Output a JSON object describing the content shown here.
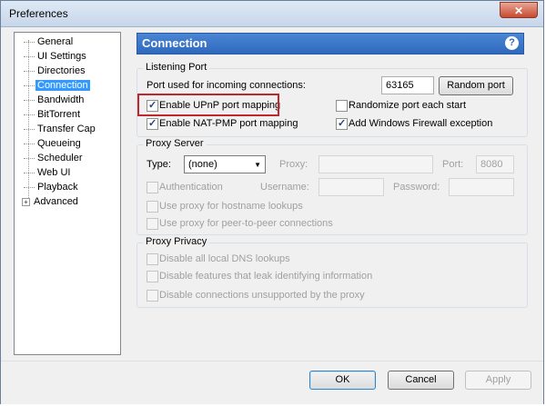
{
  "window": {
    "title": "Preferences",
    "close_glyph": "✕"
  },
  "sidebar": {
    "items": [
      {
        "label": "General"
      },
      {
        "label": "UI Settings"
      },
      {
        "label": "Directories"
      },
      {
        "label": "Connection",
        "selected": true
      },
      {
        "label": "Bandwidth"
      },
      {
        "label": "BitTorrent"
      },
      {
        "label": "Transfer Cap"
      },
      {
        "label": "Queueing"
      },
      {
        "label": "Scheduler"
      },
      {
        "label": "Web UI"
      },
      {
        "label": "Playback"
      },
      {
        "label": "Advanced",
        "expandable": true
      }
    ]
  },
  "header": {
    "title": "Connection",
    "help_glyph": "?"
  },
  "listening_port": {
    "group_label": "Listening Port",
    "port_label": "Port used for incoming connections:",
    "port_value": "63165",
    "random_port_label": "Random port",
    "upnp_label": "Enable UPnP port mapping",
    "upnp_checked": true,
    "natpmp_label": "Enable NAT-PMP port mapping",
    "natpmp_checked": true,
    "randomize_label": "Randomize port each start",
    "randomize_checked": false,
    "firewall_label": "Add Windows Firewall exception",
    "firewall_checked": true
  },
  "proxy_server": {
    "group_label": "Proxy Server",
    "type_label": "Type:",
    "type_value": "(none)",
    "proxy_label": "Proxy:",
    "proxy_value": "",
    "port_label": "Port:",
    "port_value": "8080",
    "auth_label": "Authentication",
    "username_label": "Username:",
    "password_label": "Password:",
    "hostname_lookup_label": "Use proxy for hostname lookups",
    "p2p_label": "Use proxy for peer-to-peer connections"
  },
  "proxy_privacy": {
    "group_label": "Proxy Privacy",
    "dns_label": "Disable all local DNS lookups",
    "leak_label": "Disable features that leak identifying information",
    "unsupported_label": "Disable connections unsupported by the proxy"
  },
  "footer": {
    "ok_label": "OK",
    "cancel_label": "Cancel",
    "apply_label": "Apply"
  },
  "colors": {
    "header_blue": "#2f69bd",
    "selection": "#3399ff",
    "highlight_box": "#c0272d"
  }
}
